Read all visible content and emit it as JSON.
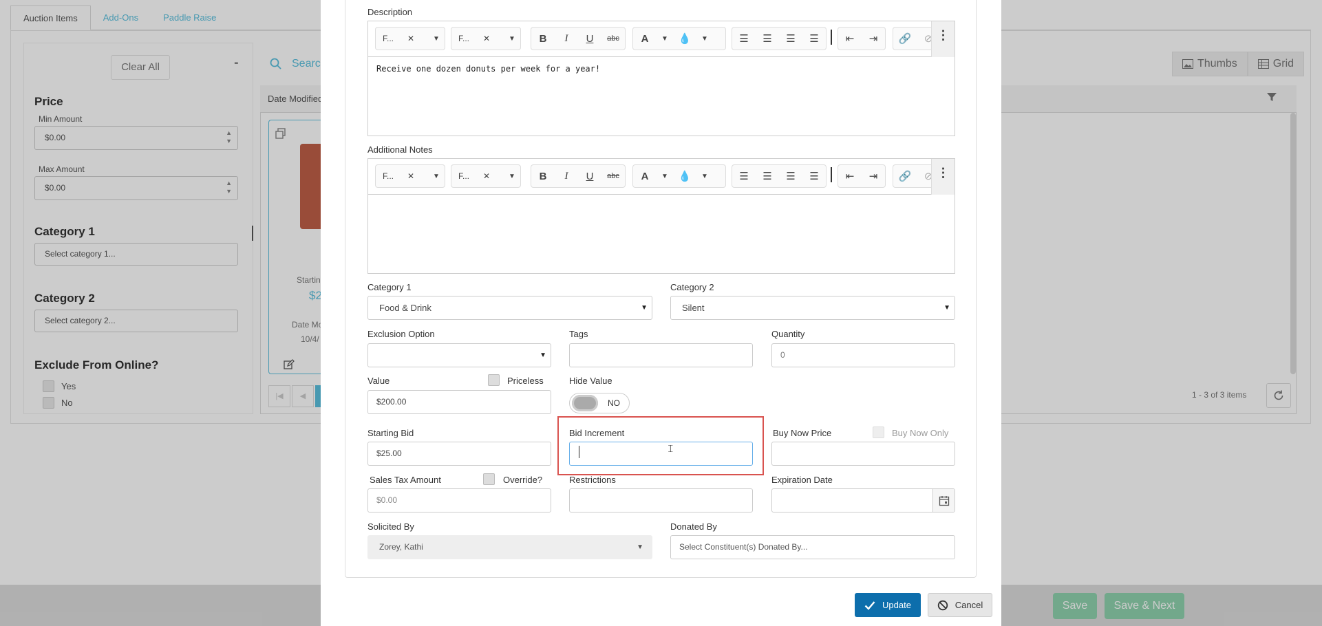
{
  "background": {
    "tabs": [
      "Auction Items",
      "Add-Ons",
      "Paddle Raise"
    ],
    "clear_all": "Clear All",
    "collapse_symbol": "-",
    "search_placeholder": "Search",
    "filters": {
      "price_heading": "Price",
      "min_label": "Min Amount",
      "min_value": "$0.00",
      "max_label": "Max Amount",
      "max_value": "$0.00",
      "cat1_heading": "Category 1",
      "cat1_placeholder": "Select category 1...",
      "cat2_heading": "Category 2",
      "cat2_placeholder": "Select category 2...",
      "exclude_heading": "Exclude From Online?",
      "yes": "Yes",
      "no": "No"
    },
    "grid": {
      "col_date_modified": "Date Modified",
      "card_starting": "Startin",
      "card_price": "$2",
      "card_date_label": "Date Mo",
      "card_date": "10/4/",
      "pager_text": "1 - 3 of 3 items"
    },
    "view_thumbs": "Thumbs",
    "view_grid": "Grid",
    "save": "Save",
    "save_next": "Save & Next"
  },
  "modal": {
    "description_label": "Description",
    "description_text": "Receive one dozen donuts per week for a year!",
    "notes_label": "Additional Notes",
    "toolbar": {
      "font_name": "F...",
      "font_size": "F...",
      "bold": "B",
      "italic": "I",
      "underline": "U",
      "strike": "abc",
      "font_color": "A"
    },
    "category1": {
      "label": "Category 1",
      "value": "Food & Drink"
    },
    "category2": {
      "label": "Category 2",
      "value": "Silent"
    },
    "exclusion": {
      "label": "Exclusion Option",
      "value": ""
    },
    "tags": {
      "label": "Tags",
      "value": ""
    },
    "quantity": {
      "label": "Quantity",
      "value": "0"
    },
    "value_field": {
      "label": "Value",
      "value": "$200.00"
    },
    "priceless": "Priceless",
    "hide_value": {
      "label": "Hide Value",
      "toggle_text": "NO"
    },
    "starting_bid": {
      "label": "Starting Bid",
      "value": "$25.00"
    },
    "bid_increment": {
      "label": "Bid Increment",
      "value": ""
    },
    "buy_now_price": {
      "label": "Buy Now Price",
      "value": ""
    },
    "buy_now_only": "Buy Now Only",
    "sales_tax": {
      "label": "Sales Tax Amount",
      "value": "$0.00"
    },
    "override": "Override?",
    "restrictions": {
      "label": "Restrictions",
      "value": ""
    },
    "expiration": {
      "label": "Expiration Date",
      "value": ""
    },
    "solicited_by": {
      "label": "Solicited By",
      "value": "Zorey, Kathi"
    },
    "donated_by": {
      "label": "Donated By",
      "placeholder": "Select Constituent(s) Donated By..."
    },
    "update": "Update",
    "cancel": "Cancel"
  },
  "colors": {
    "primary": "#0d6eac",
    "link": "#5bc0de",
    "highlight": "#d9534f",
    "save_green": "#8fd3ae"
  }
}
